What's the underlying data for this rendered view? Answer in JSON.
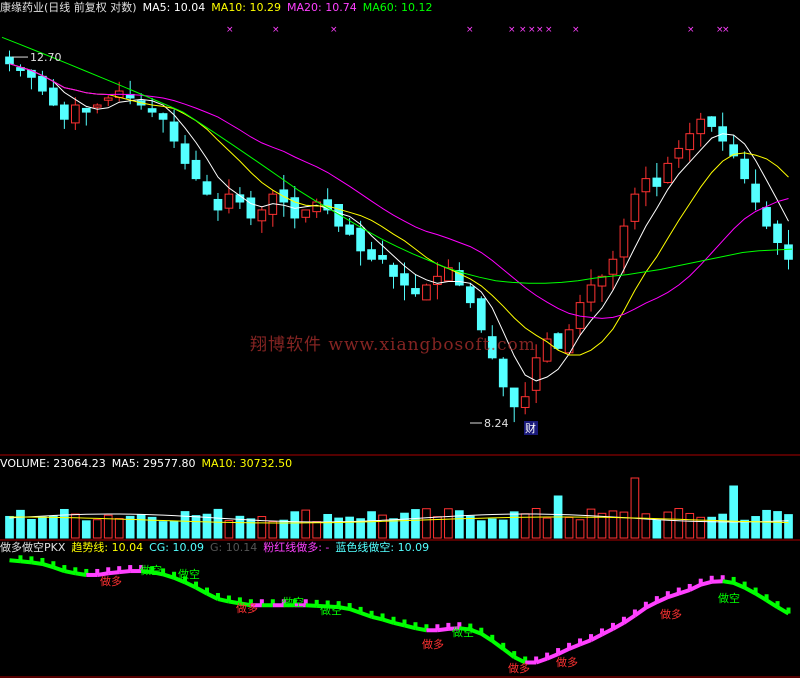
{
  "price_header": {
    "title": "康缘药业(日线 前复权 对数)",
    "ma5": "MA5: 10.04",
    "ma10": "MA10: 10.29",
    "ma20": "MA20: 10.74",
    "ma60": "MA60: 10.12"
  },
  "volume_header": {
    "volume": "VOLUME: 23064.23",
    "ma5": "MA5: 29577.80",
    "ma10": "MA10: 30732.50"
  },
  "indicator_header": {
    "name": "做多做空PKX",
    "trend": "趋势线: 10.04",
    "cg": "CG: 10.09",
    "g": "G: 10.14",
    "pink": "粉红线做多: -",
    "blue": "蓝色线做空: 10.09"
  },
  "annotations": {
    "high_label": "12.70",
    "low_label": "8.24",
    "fin_marker": "财",
    "watermark": "翔博软件 www.xiangbosoft.com",
    "long_label": "做多",
    "short_label": "做空"
  },
  "colors": {
    "up": "#ff3232",
    "down": "#54ffff",
    "ma5": "#ffffff",
    "ma10": "#ffff00",
    "ma20": "#ff00ff",
    "ma60": "#00ff00",
    "panel_border": "#aa0000",
    "pink_line": "#ff40ff",
    "green_line": "#00ff00"
  },
  "chart_data": [
    {
      "type": "candlestick",
      "title": "康缘药业(日线 前复权 对数)",
      "y_range": [
        8.0,
        13.3
      ],
      "annotated_high": 12.7,
      "annotated_low": 8.24,
      "closes": [
        12.6,
        12.5,
        12.4,
        12.2,
        12.0,
        11.8,
        12.0,
        11.9,
        12.0,
        12.1,
        12.2,
        12.1,
        12.0,
        11.9,
        11.8,
        11.5,
        11.2,
        11.0,
        10.8,
        10.6,
        10.8,
        10.7,
        10.5,
        10.6,
        10.8,
        10.7,
        10.5,
        10.6,
        10.7,
        10.6,
        10.4,
        10.3,
        10.1,
        10.0,
        10.0,
        9.8,
        9.7,
        9.6,
        9.7,
        9.8,
        9.9,
        9.7,
        9.5,
        9.2,
        8.9,
        8.6,
        8.4,
        8.5,
        8.9,
        9.1,
        9.0,
        9.2,
        9.5,
        9.7,
        9.8,
        10.0,
        10.4,
        10.8,
        11.0,
        10.9,
        11.2,
        11.4,
        11.6,
        11.8,
        11.7,
        11.5,
        11.3,
        11.0,
        10.7,
        10.4,
        10.2,
        10.0
      ],
      "ma60": [
        13.0,
        12.9,
        12.8,
        12.7,
        12.6,
        12.5,
        12.4,
        12.3,
        12.2,
        12.1,
        12.0,
        11.9,
        11.75,
        11.6,
        11.45,
        11.3,
        11.15,
        11.0,
        10.85,
        10.72,
        10.6,
        10.48,
        10.36,
        10.25,
        10.15,
        10.06,
        9.98,
        9.9,
        9.84,
        9.79,
        9.75,
        9.73,
        9.72,
        9.72,
        9.73,
        9.75,
        9.78,
        9.8,
        9.82,
        9.85,
        9.88,
        9.92,
        9.96,
        10.0,
        10.04,
        10.08,
        10.1,
        10.11,
        10.12
      ]
    },
    {
      "type": "bar",
      "title": "VOLUME",
      "last_volume": 23064.23,
      "ma5": 29577.8,
      "ma10": 30732.5
    },
    {
      "type": "line",
      "title": "做多做空PKX",
      "trend": 10.04,
      "cg": 10.09,
      "g": 10.14
    }
  ]
}
